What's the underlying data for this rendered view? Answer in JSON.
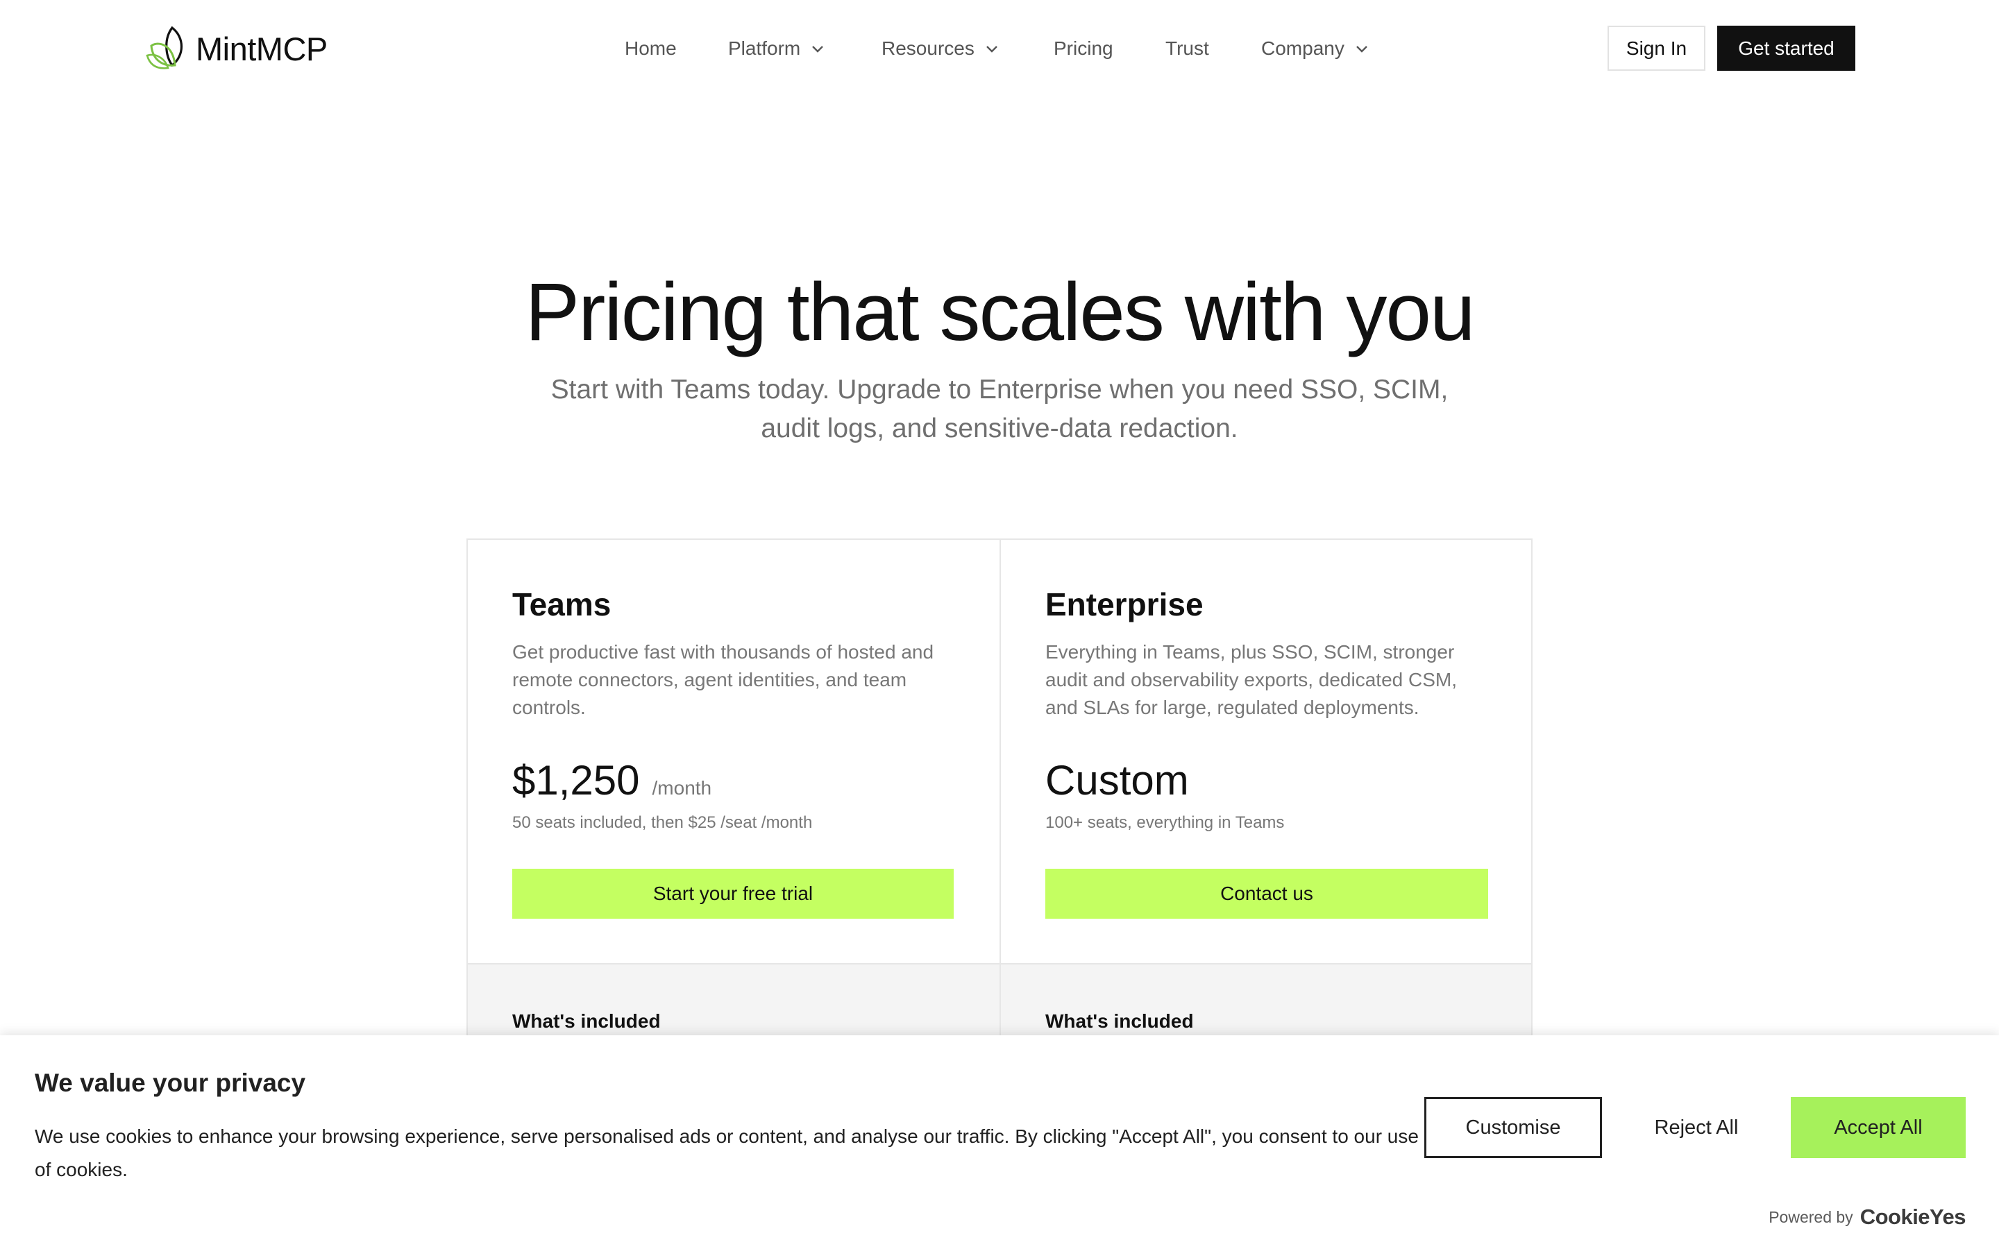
{
  "brand": {
    "name": "MintMCP",
    "accent": "#c4ff61",
    "logo_colors": [
      "#111111",
      "#7bc142"
    ]
  },
  "nav": {
    "items": [
      {
        "label": "Home",
        "has_dropdown": false
      },
      {
        "label": "Platform",
        "has_dropdown": true
      },
      {
        "label": "Resources",
        "has_dropdown": true
      },
      {
        "label": "Pricing",
        "has_dropdown": false
      },
      {
        "label": "Trust",
        "has_dropdown": false
      },
      {
        "label": "Company",
        "has_dropdown": true
      }
    ],
    "sign_in": "Sign In",
    "get_started": "Get started"
  },
  "hero": {
    "title": "Pricing that scales with you",
    "subtitle": "Start with Teams today. Upgrade to Enterprise when you need SSO, SCIM, audit logs, and sensitive-data redaction."
  },
  "plans": [
    {
      "name": "Teams",
      "description": "Get productive fast with thousands of hosted and remote connectors, agent identities, and team controls.",
      "price": "$1,250",
      "price_unit": "/month",
      "seats": "50 seats included, then $25 /seat /month",
      "cta": "Start your free trial",
      "included_heading": "What's included"
    },
    {
      "name": "Enterprise",
      "description": "Everything in Teams, plus SSO, SCIM, stronger audit and observability exports, dedicated CSM, and SLAs for large, regulated deployments.",
      "price": "Custom",
      "price_unit": "",
      "seats": "100+ seats, everything in Teams",
      "cta": "Contact us",
      "included_heading": "What's included"
    }
  ],
  "cookie_banner": {
    "title": "We value your privacy",
    "text": "We use cookies to enhance your browsing experience, serve personalised ads or content, and analyse our traffic. By clicking \"Accept All\", you consent to our use of cookies.",
    "customise": "Customise",
    "reject_all": "Reject All",
    "accept_all": "Accept All",
    "powered_by": "Powered by",
    "powered_brand": "CookieYes",
    "accept_color": "#a6f15b"
  }
}
